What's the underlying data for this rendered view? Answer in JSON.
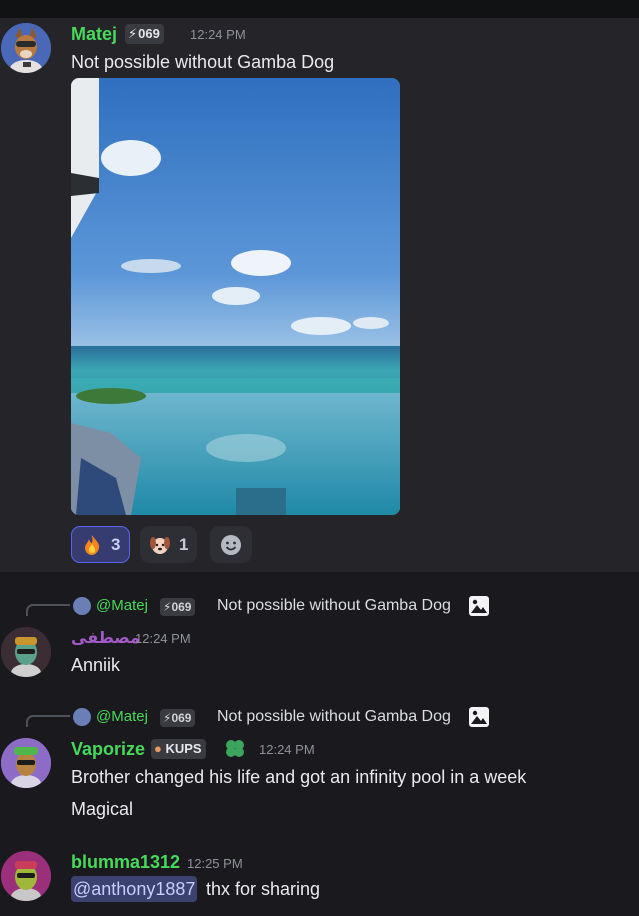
{
  "messages": [
    {
      "username": "Matej",
      "username_color": "#46d95a",
      "tag": "069",
      "time": "12:24 PM",
      "text": "Not possible without Gamba Dog",
      "reactions": [
        {
          "emoji": "fire",
          "count": "3",
          "active": true
        },
        {
          "emoji": "dog-face",
          "count": "1",
          "active": false
        }
      ]
    },
    {
      "reply": {
        "name": "@Matej",
        "tag": "069",
        "text": "Not possible without Gamba Dog"
      },
      "username": "مصطفى",
      "username_color": "#a25ac7",
      "time": "12:24 PM",
      "text": "Anniik"
    },
    {
      "reply": {
        "name": "@Matej",
        "tag": "069",
        "text": "Not possible without Gamba Dog"
      },
      "username": "Vaporize",
      "username_color": "#46d95a",
      "tag": "KUPS",
      "time": "12:24 PM",
      "text": "Brother changed his life and got an infinity pool in a week",
      "text2": "Magical"
    },
    {
      "username": "blumma1312",
      "username_color": "#46d95a",
      "time": "12:25 PM",
      "mention": "@anthony1887",
      "text": "thx for sharing"
    }
  ],
  "colors": {
    "background": "#1a1a1e",
    "highlighted_message": "#242429",
    "mention_bg": "#3c4270",
    "reaction_active_border": "#5865f2"
  }
}
